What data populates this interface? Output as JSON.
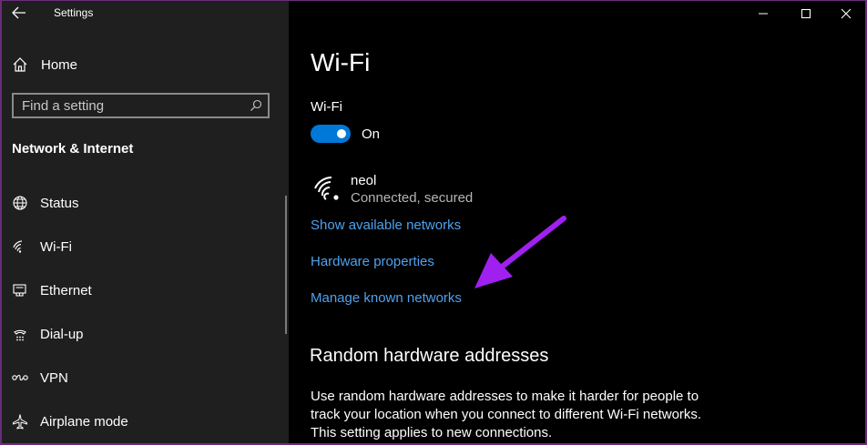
{
  "window": {
    "title": "Settings"
  },
  "sidebar": {
    "home_label": "Home",
    "search": {
      "placeholder": "Find a setting"
    },
    "section_title": "Network & Internet",
    "items": [
      {
        "label": "Status",
        "icon": "globe-icon"
      },
      {
        "label": "Wi-Fi",
        "icon": "wifi-icon"
      },
      {
        "label": "Ethernet",
        "icon": "ethernet-icon"
      },
      {
        "label": "Dial-up",
        "icon": "dialup-icon"
      },
      {
        "label": "VPN",
        "icon": "vpn-icon"
      },
      {
        "label": "Airplane mode",
        "icon": "airplane-icon"
      }
    ]
  },
  "main": {
    "page_title": "Wi-Fi",
    "wifi_label": "Wi-Fi",
    "toggle_state": "On",
    "network": {
      "name": "neol",
      "status": "Connected, secured"
    },
    "links": {
      "show_networks": "Show available networks",
      "hardware_properties": "Hardware properties",
      "manage_networks": "Manage known networks"
    },
    "random_hw": {
      "heading": "Random hardware addresses",
      "description": "Use random hardware addresses to make it harder for people to track your location when you connect to different Wi-Fi networks. This setting applies to new connections."
    }
  },
  "colors": {
    "accent": "#0078d7",
    "link": "#4ea2ef",
    "sidebar_bg": "#1f1f1f",
    "main_bg": "#000000",
    "annotation_arrow": "#a020f0"
  }
}
